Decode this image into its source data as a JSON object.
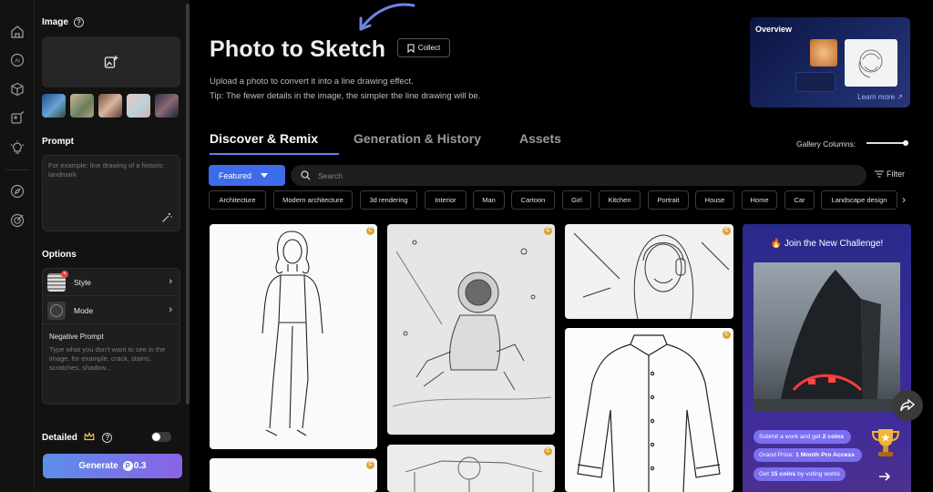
{
  "rail": {
    "icons": [
      "home-icon",
      "ai-icon",
      "cube-icon",
      "image-edit-icon",
      "lightbulb-icon",
      "compass-icon",
      "target-icon"
    ]
  },
  "sidebar": {
    "image_label": "Image",
    "prompt_label": "Prompt",
    "prompt_placeholder": "For example: line drawing of a historic landmark",
    "options_label": "Options",
    "style_label": "Style",
    "mode_label": "Mode",
    "negative_prompt_label": "Negative Prompt",
    "negative_prompt_placeholder": "Type what you don't want to see in the image, for example, crack, stains, scratches, shadow...",
    "detailed_label": "Detailed",
    "detailed_on": false,
    "generate_label": "Generate",
    "generate_cost": "0.3"
  },
  "header": {
    "title": "Photo to Sketch",
    "collect_label": "Collect",
    "desc_line1": "Upload a photo to convert it into a line drawing effect.",
    "desc_line2": "Tip: The fewer details in the image, the simpler the line drawing will be."
  },
  "overview": {
    "title": "Overview",
    "learn_more": "Learn more ↗"
  },
  "tabs": [
    {
      "label": "Discover & Remix",
      "active": true
    },
    {
      "label": "Generation & History",
      "active": false
    },
    {
      "label": "Assets",
      "active": false
    }
  ],
  "gallery_columns_label": "Gallery Columns:",
  "featured_label": "Featured",
  "search_placeholder": "Search",
  "filter_label": "Filter",
  "categories": [
    "Architecture",
    "Modern architecture",
    "3d rendering",
    "Interior",
    "Man",
    "Cartoon",
    "Girl",
    "Kitchen",
    "Portrait",
    "House",
    "Home",
    "Car",
    "Landscape design"
  ],
  "challenge": {
    "title": "Join the New Challenge!",
    "line1_pre": "Submit a work and get",
    "line1_bold": "2 coins",
    "line2_pre": "Grand Prize:",
    "line2_bold": "1 Month Pro Access",
    "line3_pre": "Get",
    "line3_bold": "15 coins",
    "line3_post": "by voting works"
  },
  "colors": {
    "accent": "#3d6bea",
    "tab_underline": "#6d7df0",
    "challenge_bg": "#3c2a9c"
  }
}
